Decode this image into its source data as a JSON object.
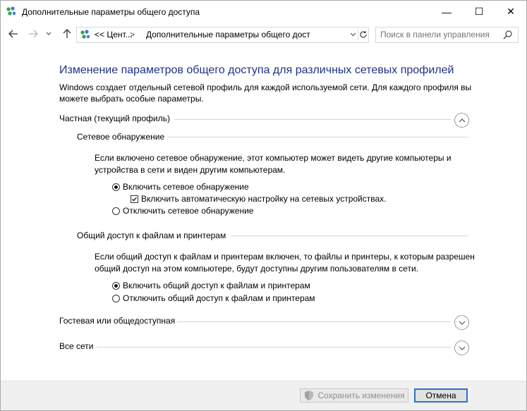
{
  "window": {
    "title": "Дополнительные параметры общего доступа",
    "minimize_glyph": "—",
    "maximize_glyph": "☐",
    "close_glyph": "✕"
  },
  "nav": {
    "back_icon": "arrow-left-icon",
    "forward_icon": "arrow-right-icon",
    "recent_icon": "chevron-down-icon",
    "up_icon": "arrow-up-icon",
    "address_parts": [
      "<< Цент...",
      ">",
      "Дополнительные параметры общего дост"
    ],
    "search_placeholder": "Поиск в панели управления"
  },
  "page": {
    "title": "Изменение параметров общего доступа для различных сетевых профилей",
    "description": "Windows создает отдельный сетевой профиль для каждой используемой сети. Для каждого профиля вы можете выбрать особые параметры."
  },
  "sections": {
    "private": {
      "label": "Частная (текущий профиль)",
      "expanded": true,
      "discovery": {
        "heading": "Сетевое обнаружение",
        "text": "Если включено сетевое обнаружение, этот компьютер может видеть другие компьютеры и устройства в сети и виден другим компьютерам.",
        "option_on": "Включить сетевое обнаружение",
        "auto_setup": "Включить автоматическую настройку на сетевых устройствах.",
        "option_off": "Отключить сетевое обнаружение",
        "selected": "on",
        "auto_setup_checked": true
      },
      "sharing": {
        "heading": "Общий доступ к файлам и принтерам",
        "text": "Если общий доступ к файлам и принтерам включен, то файлы и принтеры, к которым разрешен общий доступ на этом компьютере, будут доступны другим пользователям в сети.",
        "option_on": "Включить общий доступ к файлам и принтерам",
        "option_off": "Отключить общий доступ к файлам и принтерам",
        "selected": "on"
      }
    },
    "guest": {
      "label": "Гостевая или общедоступная",
      "expanded": false
    },
    "all": {
      "label": "Все сети",
      "expanded": false
    }
  },
  "footer": {
    "save_label": "Сохранить изменения",
    "cancel_label": "Отмена"
  },
  "colors": {
    "title_blue": "#1e3287",
    "accent_blue": "#2e73c8"
  }
}
